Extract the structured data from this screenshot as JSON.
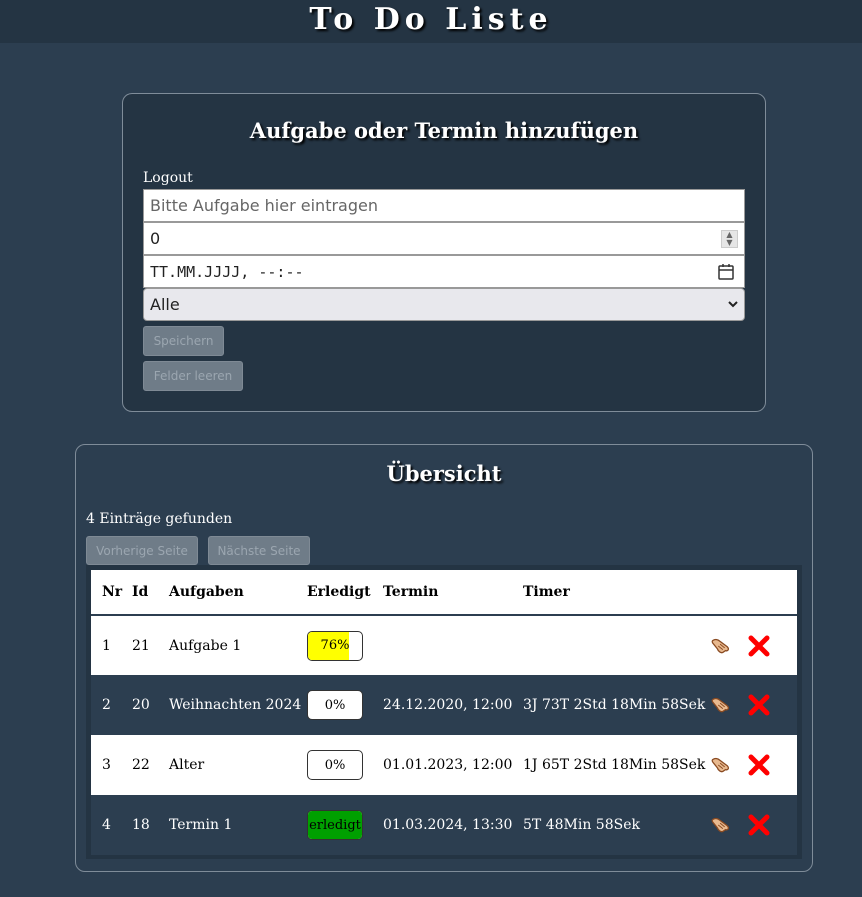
{
  "header": {
    "title": "To Do Liste"
  },
  "add_card": {
    "title": "Aufgabe oder Termin hinzufügen",
    "logout": "Logout",
    "task_placeholder": "Bitte Aufgabe hier eintragen",
    "number_value": "0",
    "date_placeholder": "TT.MM.JJJJ, --:--",
    "select_value": "Alle",
    "save_label": "Speichern",
    "clear_label": "Felder leeren"
  },
  "list_card": {
    "title": "Übersicht",
    "count_text": "4 Einträge gefunden",
    "prev_label": "Vorherige Seite",
    "next_label": "Nächste Seite",
    "columns": [
      "Nr",
      "Id",
      "Aufgaben",
      "Erledigt",
      "Termin",
      "Timer"
    ],
    "rows": [
      {
        "nr": "1",
        "id": "21",
        "task": "Aufgabe 1",
        "done_label": "76%",
        "done_fraction": 0.76,
        "done_color": "#ffff00",
        "date": "",
        "timer": ""
      },
      {
        "nr": "2",
        "id": "20",
        "task": "Weihnachten 2024",
        "done_label": "0%",
        "done_fraction": 0,
        "done_color": "#ffffff",
        "date": "24.12.2020, 12:00",
        "timer": "3J 73T 2Std 18Min 58Sek"
      },
      {
        "nr": "3",
        "id": "22",
        "task": "Alter",
        "done_label": "0%",
        "done_fraction": 0,
        "done_color": "#ffffff",
        "date": "01.01.2023, 12:00",
        "timer": "1J 65T 2Std 18Min 58Sek"
      },
      {
        "nr": "4",
        "id": "18",
        "task": "Termin 1",
        "done_label": "erledigt",
        "done_fraction": 1,
        "done_color": "#00a000",
        "date": "01.03.2024, 13:30",
        "timer": "5T 48Min 58Sek"
      }
    ],
    "row_icons": {
      "edit": "hand-pointing-icon",
      "delete": "red-x-icon"
    }
  }
}
